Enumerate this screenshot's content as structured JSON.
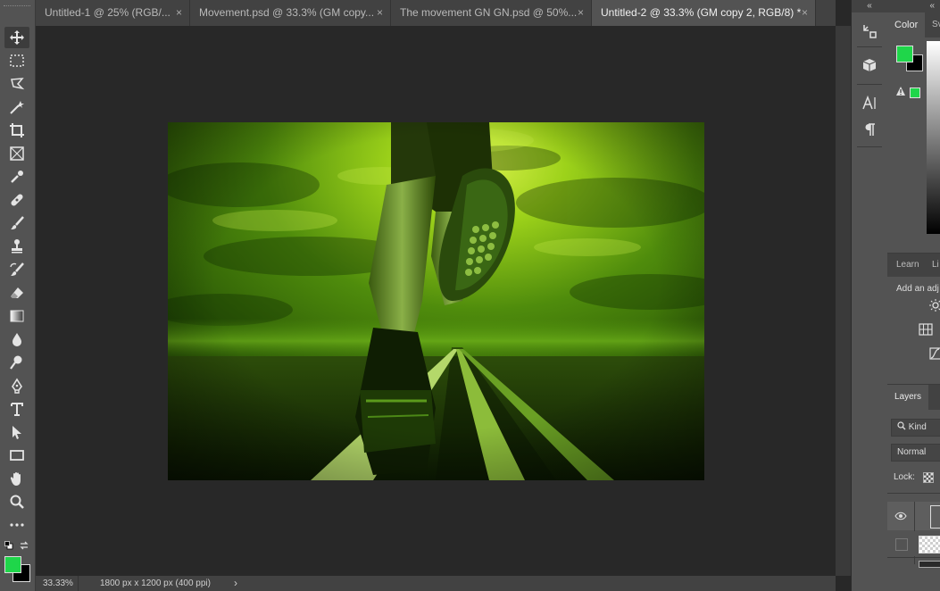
{
  "tabs": [
    {
      "label": "Untitled-1 @ 25% (RGB/...",
      "close": "×"
    },
    {
      "label": "Movement.psd @ 33.3% (GM copy...",
      "close": "×"
    },
    {
      "label": "The movement GN GN.psd @ 50%...",
      "close": "×"
    },
    {
      "label": "Untitled-2 @ 33.3% (GM copy 2, RGB/8) *",
      "close": "×"
    }
  ],
  "status": {
    "zoom": "33.33%",
    "doc_info": "1800 px x 1200 px (400 ppi)",
    "arrow": "›"
  },
  "toolbar": {
    "collapse": "«"
  },
  "colors": {
    "foreground": "#1fd64a",
    "background": "#000000",
    "panel_swatch": "#1fd64a"
  },
  "panels": {
    "expand": "«",
    "color_tab": "Color",
    "swatches_tab": "Sv",
    "learn_tab": "Learn",
    "libraries_tab": "Li",
    "adjust_text": "Add an adj",
    "layers_tab": "Layers",
    "kind_label": "Kind",
    "blend_mode": "Normal",
    "lock_label": "Lock:"
  }
}
